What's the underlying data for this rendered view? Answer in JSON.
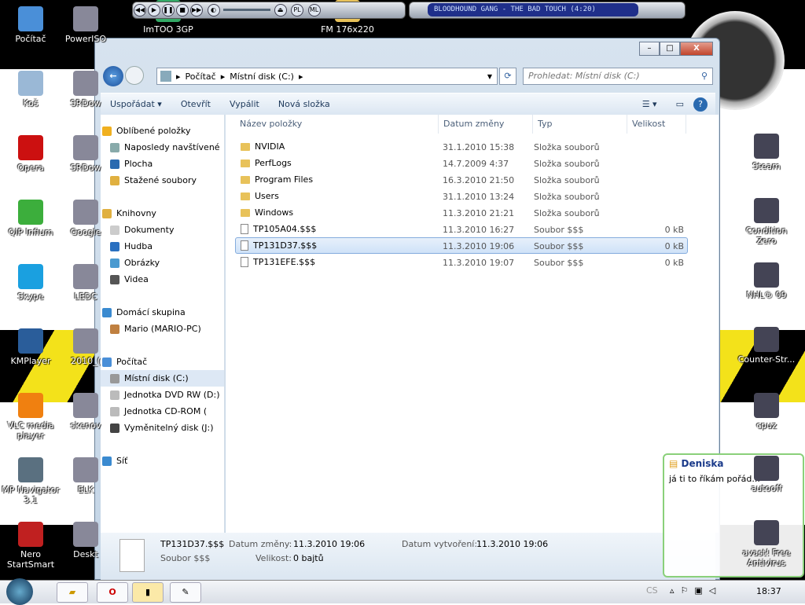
{
  "desktop": {
    "left_icons": [
      {
        "label": "Počítač",
        "color": "#4a8fd8"
      },
      {
        "label": "Koš",
        "color": "#9ab8d6"
      },
      {
        "label": "Opera",
        "color": "#cc1010"
      },
      {
        "label": "QIP Infium",
        "color": "#3cae3c"
      },
      {
        "label": "Skype",
        "color": "#1aa0e0"
      },
      {
        "label": "KMPlayer",
        "color": "#2a5d9a"
      },
      {
        "label": "VLC media player",
        "color": "#f08010"
      },
      {
        "label": "MP Navigator 3.1",
        "color": "#5a7080"
      },
      {
        "label": "Nero StartSmart",
        "color": "#c02020"
      }
    ],
    "second_col": [
      {
        "label": "PowerISO"
      },
      {
        "label": "SRDow"
      },
      {
        "label": "SRDow"
      },
      {
        "label": "Google"
      },
      {
        "label": "LEDC"
      },
      {
        "label": "2010_("
      },
      {
        "label": "skenov"
      },
      {
        "label": "ELK"
      },
      {
        "label": "Deskt"
      }
    ],
    "top_icons": [
      {
        "label": "ImTOO 3GP"
      },
      {
        "label": "FM 176x220"
      }
    ],
    "right_icons": [
      {
        "label": "Steam"
      },
      {
        "label": "Condition Zero"
      },
      {
        "label": "NHL® 09"
      },
      {
        "label": "Counter-Str..."
      },
      {
        "label": "cpuz"
      },
      {
        "label": "autooff"
      },
      {
        "label": "avast! Free Antivirus"
      }
    ]
  },
  "media_player": {
    "track": "BLOODHOUND GANG - THE BAD TOUCH (4:20)",
    "buttons": [
      "PL",
      "ML"
    ]
  },
  "explorer": {
    "breadcrumb": [
      "Počítač",
      "Místní disk (C:)"
    ],
    "search_placeholder": "Prohledat: Místní disk (C:)",
    "toolbar": {
      "organize": "Uspořádat",
      "open": "Otevřít",
      "burn": "Vypálit",
      "new_folder": "Nová složka"
    },
    "nav": [
      {
        "label": "Oblíbené položky",
        "top": true,
        "color": "#f0b020"
      },
      {
        "label": "Naposledy navštívené",
        "color": "#8aa"
      },
      {
        "label": "Plocha",
        "color": "#2a6ab0"
      },
      {
        "label": "Stažené soubory",
        "color": "#e0b040"
      },
      {
        "gap": true
      },
      {
        "label": "Knihovny",
        "top": true,
        "color": "#e0b040"
      },
      {
        "label": "Dokumenty",
        "color": "#ccc"
      },
      {
        "label": "Hudba",
        "color": "#2a70c0"
      },
      {
        "label": "Obrázky",
        "color": "#4a9ad0"
      },
      {
        "label": "Videa",
        "color": "#555"
      },
      {
        "gap": true
      },
      {
        "label": "Domácí skupina",
        "top": true,
        "color": "#3a8ad0"
      },
      {
        "label": "Mario (MARIO-PC)",
        "color": "#c08040"
      },
      {
        "gap": true
      },
      {
        "label": "Počítač",
        "top": true,
        "color": "#4a8fd8"
      },
      {
        "label": "Místní disk (C:)",
        "color": "#999",
        "selected": true
      },
      {
        "label": "Jednotka DVD RW (D:)",
        "color": "#bbb"
      },
      {
        "label": "Jednotka CD-ROM (",
        "color": "#bbb"
      },
      {
        "label": "Vyměnitelný disk (J:)",
        "color": "#444"
      },
      {
        "gap": true
      },
      {
        "label": "Síť",
        "top": true,
        "color": "#3a8ad0"
      }
    ],
    "columns": [
      "Název položky",
      "Datum změny",
      "Typ",
      "Velikost"
    ],
    "files": [
      {
        "name": "NVIDIA",
        "date": "31.1.2010 15:38",
        "type": "Složka souborů",
        "size": "",
        "folder": true
      },
      {
        "name": "PerfLogs",
        "date": "14.7.2009 4:37",
        "type": "Složka souborů",
        "size": "",
        "folder": true
      },
      {
        "name": "Program Files",
        "date": "16.3.2010 21:50",
        "type": "Složka souborů",
        "size": "",
        "folder": true
      },
      {
        "name": "Users",
        "date": "31.1.2010 13:24",
        "type": "Složka souborů",
        "size": "",
        "folder": true
      },
      {
        "name": "Windows",
        "date": "11.3.2010 21:21",
        "type": "Složka souborů",
        "size": "",
        "folder": true
      },
      {
        "name": "TP105A04.$$$",
        "date": "11.3.2010 16:27",
        "type": "Soubor $$$",
        "size": "0 kB"
      },
      {
        "name": "TP131D37.$$$",
        "date": "11.3.2010 19:06",
        "type": "Soubor $$$",
        "size": "0 kB",
        "selected": true
      },
      {
        "name": "TP131EFE.$$$",
        "date": "11.3.2010 19:07",
        "type": "Soubor $$$",
        "size": "0 kB"
      }
    ],
    "details": {
      "name": "TP131D37.$$$",
      "type": "Soubor $$$",
      "modified_label": "Datum změny:",
      "modified": "11.3.2010 19:06",
      "created_label": "Datum vytvoření:",
      "created": "11.3.2010 19:06",
      "size_label": "Velikost:",
      "size": "0 bajtů"
    }
  },
  "chat": {
    "contact": "Deniska",
    "message": "já ti to říkám pořád..."
  },
  "taskbar": {
    "lang": "CS",
    "time": "18:37"
  }
}
